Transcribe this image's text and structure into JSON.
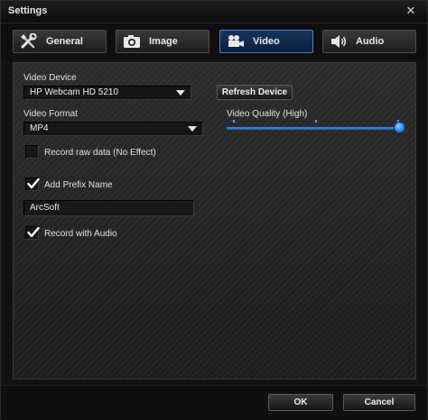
{
  "window": {
    "title": "Settings"
  },
  "tabs": [
    {
      "label": "General",
      "icon": "tools-icon",
      "active": false
    },
    {
      "label": "Image",
      "icon": "camera-icon",
      "active": false
    },
    {
      "label": "Video",
      "icon": "video-camera-icon",
      "active": true
    },
    {
      "label": "Audio",
      "icon": "speaker-icon",
      "active": false
    }
  ],
  "video": {
    "device_label": "Video Device",
    "device_value": "HP Webcam HD 5210",
    "refresh_label": "Refresh Device",
    "format_label": "Video Format",
    "format_value": "MP4",
    "quality_label": "Video Quality  (High)",
    "quality_level": 1.0,
    "raw_label": "Record raw data (No Effect)",
    "raw_checked": false,
    "prefix_label": "Add Prefix Name",
    "prefix_checked": true,
    "prefix_value": "ArcSoft",
    "audio_label": "Record with Audio",
    "audio_checked": true
  },
  "footer": {
    "ok_label": "OK",
    "cancel_label": "Cancel"
  },
  "colors": {
    "accent": "#2f7ee0",
    "active_tab": "#17345e"
  }
}
